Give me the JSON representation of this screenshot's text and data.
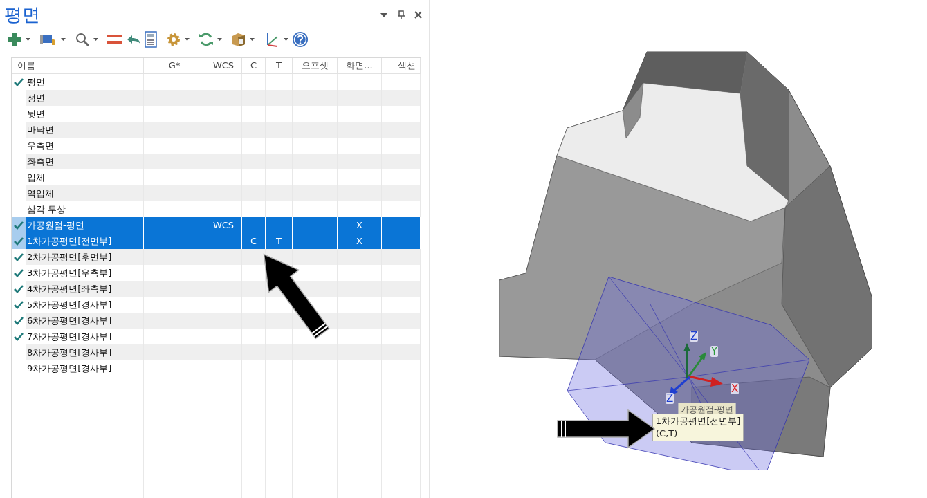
{
  "panel": {
    "title": "평면",
    "columns": [
      "이름",
      "G*",
      "WCS",
      "C",
      "T",
      "오프셋",
      "화면...",
      "섹션"
    ],
    "rows": [
      {
        "name": "평면",
        "checked": true,
        "selected": false
      },
      {
        "name": "정면",
        "checked": false,
        "selected": false
      },
      {
        "name": "뒷면",
        "checked": false,
        "selected": false
      },
      {
        "name": "바닥면",
        "checked": false,
        "selected": false
      },
      {
        "name": "우측면",
        "checked": false,
        "selected": false
      },
      {
        "name": "좌측면",
        "checked": false,
        "selected": false
      },
      {
        "name": "입체",
        "checked": false,
        "selected": false
      },
      {
        "name": "역입체",
        "checked": false,
        "selected": false
      },
      {
        "name": "삼각 투상",
        "checked": false,
        "selected": false
      },
      {
        "name": "가공원점-평면",
        "checked": true,
        "selected": true,
        "wcs": "WCS",
        "display": "X"
      },
      {
        "name": "1차가공평면[전면부]",
        "checked": true,
        "selected": true,
        "c": "C",
        "t": "T",
        "display": "X"
      },
      {
        "name": "2차가공평면[후면부]",
        "checked": true,
        "selected": false
      },
      {
        "name": "3차가공평면[우측부]",
        "checked": true,
        "selected": false
      },
      {
        "name": "4차가공평면[좌측부]",
        "checked": true,
        "selected": false
      },
      {
        "name": "5차가공평면[경사부]",
        "checked": true,
        "selected": false
      },
      {
        "name": "6차가공평면[경사부]",
        "checked": true,
        "selected": false
      },
      {
        "name": "7차가공평면[경사부]",
        "checked": true,
        "selected": false
      },
      {
        "name": "8차가공평면[경사부]",
        "checked": false,
        "selected": false
      },
      {
        "name": "9차가공평면[경사부]",
        "checked": false,
        "selected": false
      }
    ]
  },
  "viewport": {
    "axis_labels": [
      {
        "text": "Z",
        "color": "#1f3fd0"
      },
      {
        "text": "Y",
        "color": "#2a9a3a"
      },
      {
        "text": "X",
        "color": "#e02020"
      },
      {
        "text": "Z",
        "color": "#1f3fd0"
      }
    ],
    "back_label": "가공원점-평면",
    "tooltip": [
      "1차가공평면[전면부]",
      "(C,T)"
    ]
  }
}
